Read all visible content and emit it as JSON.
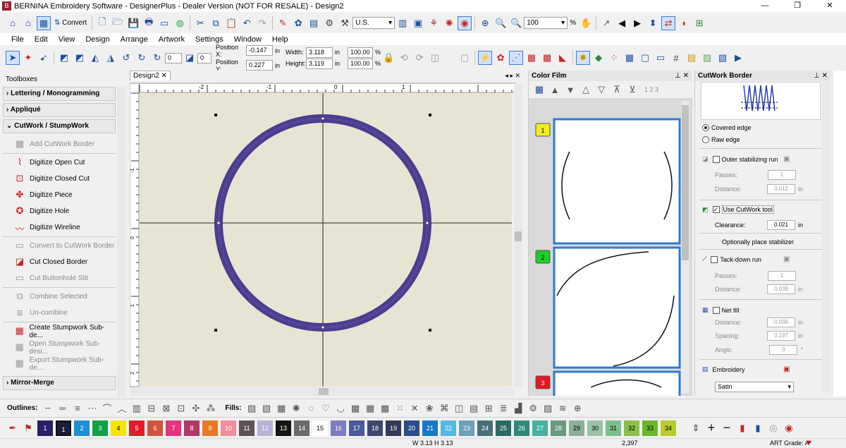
{
  "app": {
    "title": "BERNINA Embroidery Software - DesignerPlus - Dealer Version (NOT FOR RESALE) - Design2",
    "icon": "bernina-logo-icon"
  },
  "toolbar1": {
    "convert": "Convert",
    "units": "U.S.",
    "zoom": "100",
    "zoom_unit": "%"
  },
  "menu": [
    "File",
    "Edit",
    "View",
    "Design",
    "Arrange",
    "Artwork",
    "Settings",
    "Window",
    "Help"
  ],
  "toolbar2": {
    "rot_val": "0",
    "skew_val": "0",
    "pos_x_label": "Position X:",
    "pos_x": "-0.147",
    "pos_y_label": "Position Y:",
    "pos_y": "0.227",
    "unit": "in",
    "width_label": "Width:",
    "width": "3.118",
    "height_label": "Height:",
    "height": "3.119",
    "scale_w": "100.00",
    "scale_h": "100.00",
    "pct": "%"
  },
  "toolboxes": {
    "header": "Toolboxes",
    "cats": {
      "lettering": "Lettering / Monogramming",
      "applique": "Appliqué",
      "cutwork": "CutWork / StumpWork",
      "mirror": "Mirror-Merge"
    },
    "tools": [
      {
        "label": "Add CutWork Border",
        "icon": "add-border-icon",
        "dis": true
      },
      {
        "label": "Digitize Open Cut",
        "icon": "open-cut-icon",
        "dis": false
      },
      {
        "label": "Digitize Closed Cut",
        "icon": "closed-cut-icon",
        "dis": false
      },
      {
        "label": "Digitize Piece",
        "icon": "piece-icon",
        "dis": false
      },
      {
        "label": "Digitize Hole",
        "icon": "hole-icon",
        "dis": false
      },
      {
        "label": "Digitize Wireline",
        "icon": "wireline-icon",
        "dis": false
      },
      {
        "label": "Convert to CutWork Border",
        "icon": "convert-border-icon",
        "dis": true
      },
      {
        "label": "Cut Closed Border",
        "icon": "cut-border-icon",
        "dis": false
      },
      {
        "label": "Cut Buttonhole Slit",
        "icon": "buttonhole-icon",
        "dis": true
      },
      {
        "label": "Combine Selected",
        "icon": "combine-icon",
        "dis": true
      },
      {
        "label": "Un-combine",
        "icon": "uncombine-icon",
        "dis": true
      },
      {
        "label": "Create Stumpwork Sub-de...",
        "icon": "stumpwork-create-icon",
        "dis": false
      },
      {
        "label": "Open Stumpwork Sub-desi...",
        "icon": "stumpwork-open-icon",
        "dis": true
      },
      {
        "label": "Export Stumpwork Sub-de...",
        "icon": "stumpwork-export-icon",
        "dis": true
      }
    ]
  },
  "doc": {
    "tab": "Design2",
    "ruler_h": [
      "-2",
      "-1",
      "0",
      "1"
    ],
    "ruler_v": [
      "-1",
      "0",
      "1",
      "2"
    ]
  },
  "film": {
    "title": "Color Film",
    "frames": [
      "1",
      "2",
      "3"
    ],
    "colors": [
      "#f4ec1e",
      "#1ccf2a",
      "#e8161e"
    ],
    "sort": "1 2 3"
  },
  "cutwork": {
    "title": "CutWork Border",
    "covered": "Covered edge",
    "raw": "Raw edge",
    "outer": "Outer stabilizing run",
    "passes": "Passes:",
    "distance": "Distance:",
    "outer_passes": "1",
    "outer_dist": "0.012",
    "unit": "in",
    "use_tool": "Use CutWork tool",
    "clearance": "Clearance:",
    "clearance_val": "0.021",
    "stabilizer": "Optionally place stabilizer",
    "tack": "Tack-down run",
    "tack_passes": "1",
    "tack_dist": "0.039",
    "net": "Net fill",
    "net_dist": "0.039",
    "spacing": "Spacing:",
    "spacing_val": "0.197",
    "angle": "Angle:",
    "angle_val": "0",
    "deg": "°",
    "embroidery": "Embroidery",
    "emb_type": "Satin"
  },
  "bottom": {
    "outlines": "Outlines:",
    "fills": "Fills:"
  },
  "palette": [
    {
      "n": "1",
      "c": "#2a1f6b"
    },
    {
      "n": "1",
      "c": "#1b1b3a"
    },
    {
      "n": "2",
      "c": "#1e90d6"
    },
    {
      "n": "3",
      "c": "#13a048"
    },
    {
      "n": "4",
      "c": "#f7e400"
    },
    {
      "n": "5",
      "c": "#e11d2a"
    },
    {
      "n": "6",
      "c": "#d1543d"
    },
    {
      "n": "7",
      "c": "#e2357e"
    },
    {
      "n": "8",
      "c": "#b03a66"
    },
    {
      "n": "9",
      "c": "#e67a24"
    },
    {
      "n": "10",
      "c": "#f18e9e"
    },
    {
      "n": "11",
      "c": "#5c5454"
    },
    {
      "n": "12",
      "c": "#b7b2d8"
    },
    {
      "n": "13",
      "c": "#141414"
    },
    {
      "n": "14",
      "c": "#6b6b6b"
    },
    {
      "n": "15",
      "c": "#ffffff"
    },
    {
      "n": "16",
      "c": "#7c7cc0"
    },
    {
      "n": "17",
      "c": "#4b5a9a"
    },
    {
      "n": "18",
      "c": "#3e4770"
    },
    {
      "n": "19",
      "c": "#33395a"
    },
    {
      "n": "20",
      "c": "#2a4d8c"
    },
    {
      "n": "21",
      "c": "#1a78c8"
    },
    {
      "n": "22",
      "c": "#56b8e0"
    },
    {
      "n": "23",
      "c": "#6aa0b8"
    },
    {
      "n": "24",
      "c": "#48707c"
    },
    {
      "n": "25",
      "c": "#2c6a66"
    },
    {
      "n": "26",
      "c": "#2d8a78"
    },
    {
      "n": "27",
      "c": "#48b0a0"
    },
    {
      "n": "28",
      "c": "#6a9a80"
    },
    {
      "n": "29",
      "c": "#8cb09a"
    },
    {
      "n": "30",
      "c": "#9ac2a4"
    },
    {
      "n": "31",
      "c": "#7ec08c"
    },
    {
      "n": "32",
      "c": "#8ac04a"
    },
    {
      "n": "33",
      "c": "#6ab82a"
    },
    {
      "n": "34",
      "c": "#b8cc2a"
    }
  ],
  "status": {
    "size": "W 3.13 H 3.13",
    "stitches": "2,397",
    "grade": "ART Grade: A"
  }
}
